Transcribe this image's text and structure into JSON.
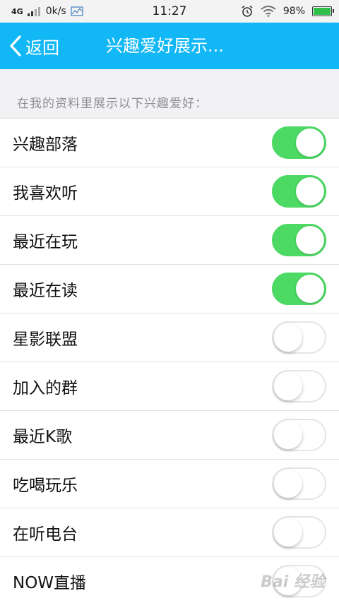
{
  "status_bar": {
    "network": "4G",
    "speed": "0k/s",
    "time": "11:27",
    "battery": "98%",
    "battery_level": 0.98
  },
  "nav": {
    "back_label": "返回",
    "title": "兴趣爱好展示..."
  },
  "section_header": "在我的资料里展示以下兴趣爱好：",
  "items": [
    {
      "label": "兴趣部落",
      "on": true
    },
    {
      "label": "我喜欢听",
      "on": true
    },
    {
      "label": "最近在玩",
      "on": true
    },
    {
      "label": "最近在读",
      "on": true
    },
    {
      "label": "星影联盟",
      "on": false
    },
    {
      "label": "加入的群",
      "on": false
    },
    {
      "label": "最近K歌",
      "on": false
    },
    {
      "label": "吃喝玩乐",
      "on": false
    },
    {
      "label": "在听电台",
      "on": false
    },
    {
      "label": "NOW直播",
      "on": false
    }
  ],
  "colors": {
    "nav_bg": "#12b7f5",
    "toggle_on": "#4cd964"
  },
  "icons": {
    "back": "chevron-left-icon",
    "alarm": "alarm-clock-icon",
    "wifi": "wifi-icon",
    "chart": "chart-icon"
  }
}
